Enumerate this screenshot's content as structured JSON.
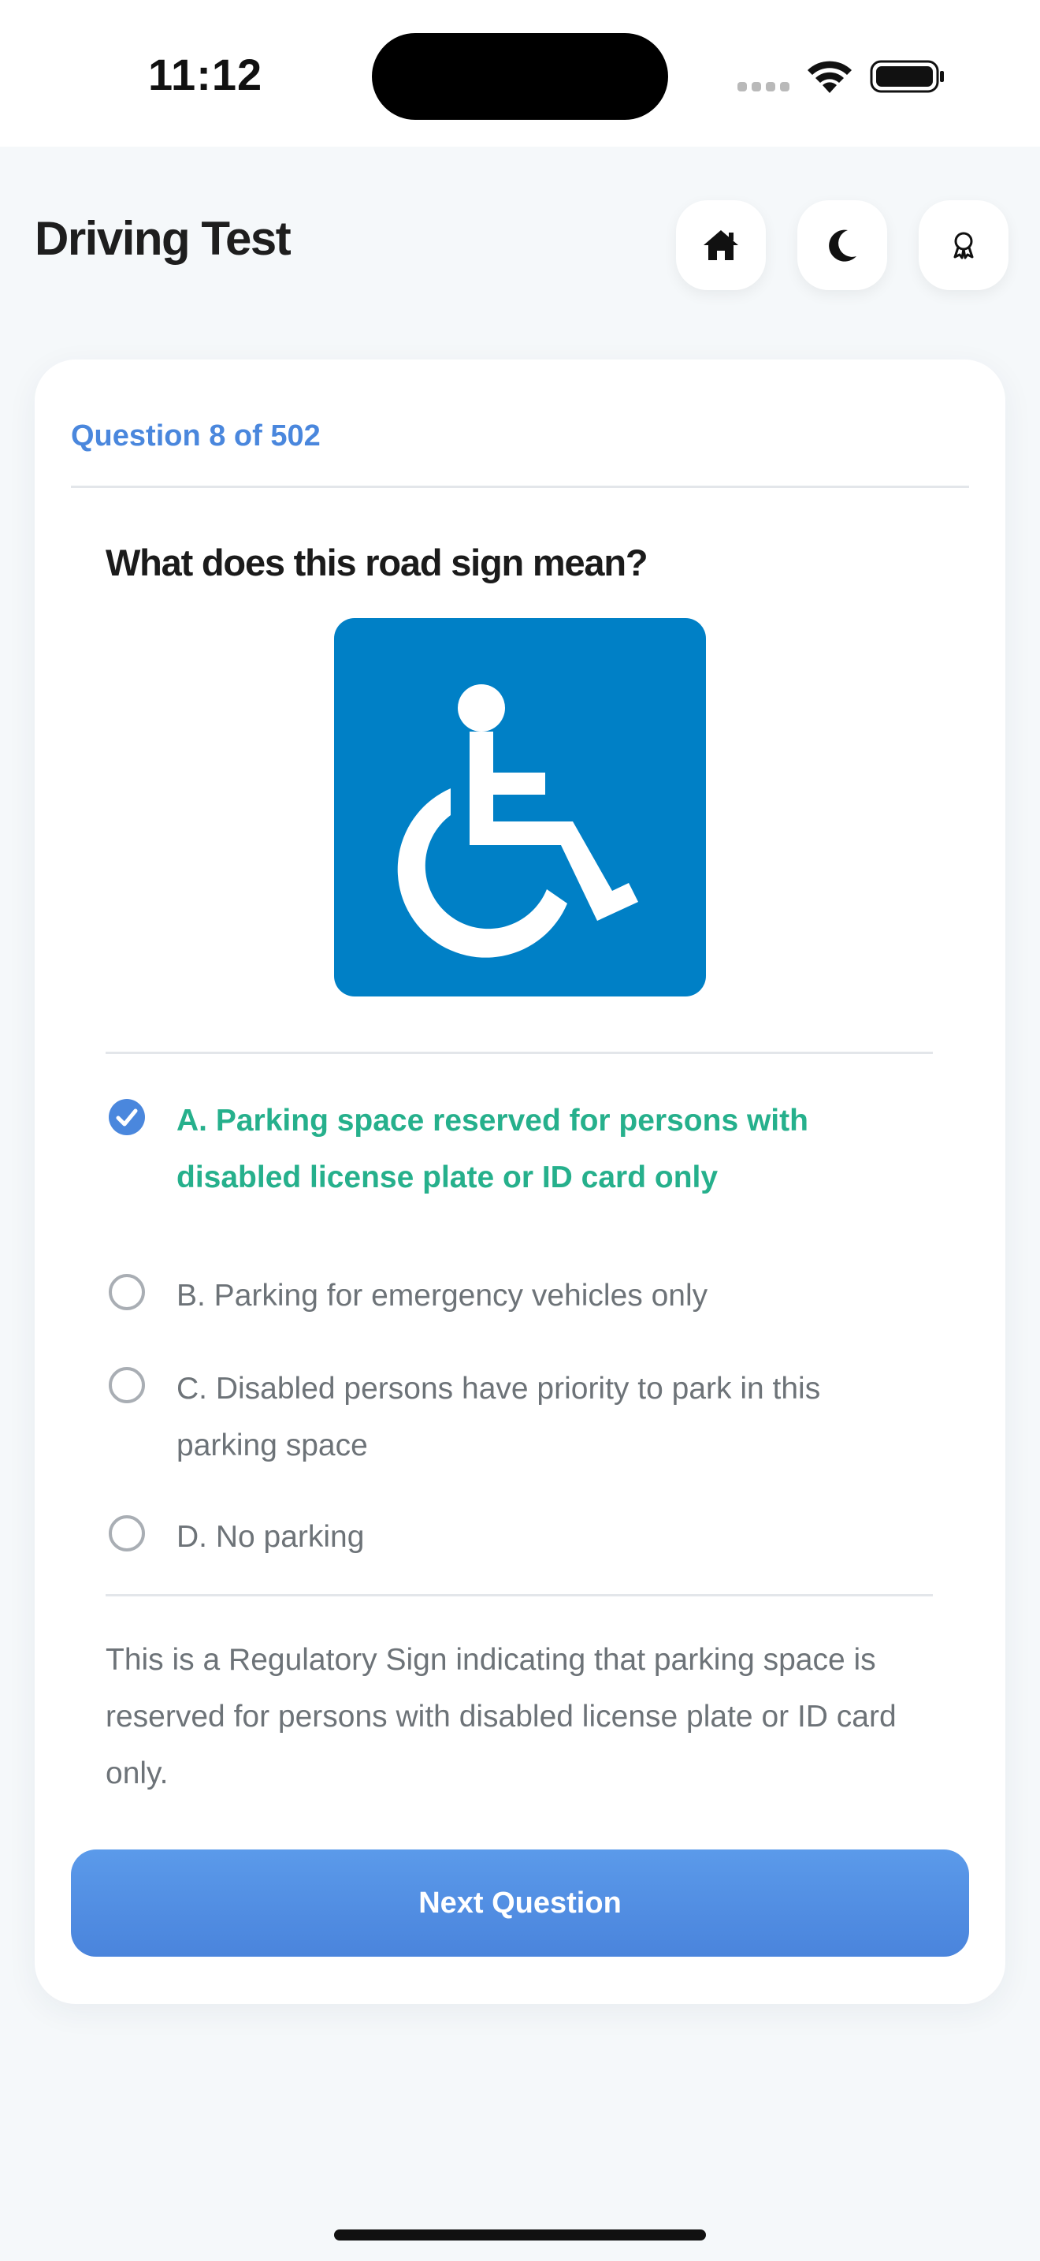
{
  "status_bar": {
    "time": "11:12"
  },
  "header": {
    "title": "Driving Test",
    "buttons": [
      {
        "icon": "home-icon"
      },
      {
        "icon": "moon-icon"
      },
      {
        "icon": "award-icon"
      }
    ]
  },
  "quiz": {
    "counter": "Question 8 of 502",
    "question": "What does this road sign mean?",
    "sign_image": {
      "icon": "wheelchair-accessible-sign",
      "background": "#0080c6",
      "symbol_color": "#ffffff"
    },
    "options": [
      {
        "text": "A. Parking space reserved for persons with disabled license plate or ID card only",
        "selected": true,
        "correct": true
      },
      {
        "text": "B. Parking for emergency vehicles only",
        "selected": false
      },
      {
        "text": "C. Disabled persons have priority to park in this parking space",
        "selected": false
      },
      {
        "text": "D. No parking",
        "selected": false
      }
    ],
    "explanation": "This is a Regulatory Sign indicating that parking space is reserved for persons with disabled license plate or ID card only.",
    "next_label": "Next Question"
  },
  "colors": {
    "accent": "#4a87dd",
    "correct": "#26b08c",
    "button_top": "#5b9aea",
    "button_bottom": "#4a84dc"
  }
}
